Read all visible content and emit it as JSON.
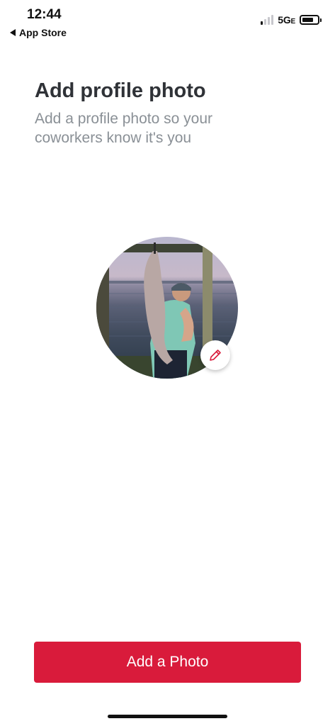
{
  "status_bar": {
    "time": "12:44",
    "back_label": "App Store",
    "network": "5G",
    "network_suffix": "E",
    "signal_bars_active": 1,
    "signal_bars_total": 4
  },
  "header": {
    "title": "Add profile photo",
    "subtitle": "Add a profile photo so your coworkers know it's you"
  },
  "avatar": {
    "edit_icon": "pencil-icon"
  },
  "primary_action": {
    "label": "Add a Photo"
  },
  "colors": {
    "accent": "#d91b3b",
    "title": "#2f3237",
    "subtitle": "#8a9096"
  }
}
